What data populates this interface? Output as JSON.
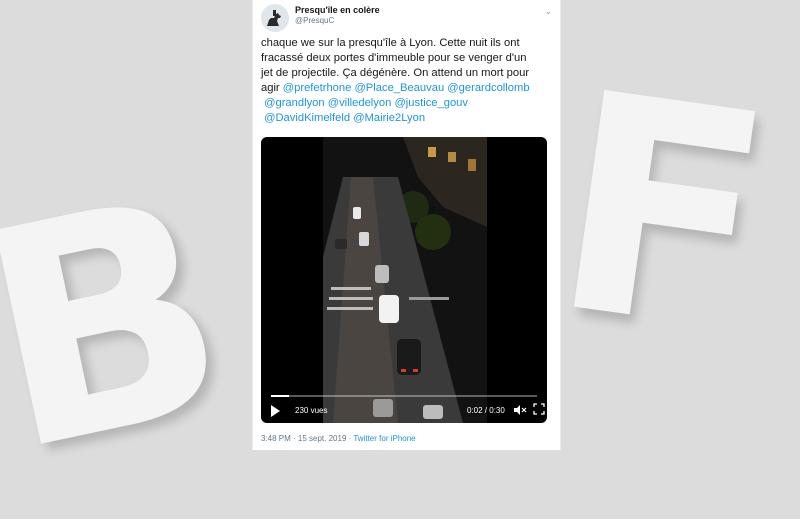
{
  "watermark": {
    "text": "BFM"
  },
  "tweet": {
    "author_name": "Presqu'île en colère",
    "author_handle": "@PresquC",
    "text_lines": [
      "chaque we sur la presqu'île à Lyon. Cette nuit ils ont",
      "fracassé deux portes d'immeuble pour se venger d'un",
      "jet de projectile. Ça dégénère. On attend un mort pour",
      "agir"
    ],
    "mentions": [
      "@prefetrhone",
      "@Place_Beauvau",
      "@gerardcollomb",
      "@grandlyon",
      "@villedelyon",
      "@justice_gouv",
      "@DavidKimelfeld",
      "@Mairie2Lyon"
    ],
    "video": {
      "views": "230 vues",
      "time": "0:02 / 0:30",
      "progress": 0.067
    },
    "timestamp": "3:48 PM · 15 sept. 2019 ·",
    "source": "Twitter for iPhone"
  }
}
